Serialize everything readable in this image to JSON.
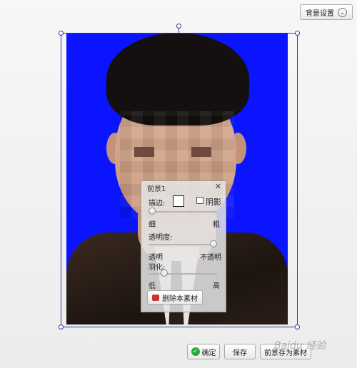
{
  "toolbar": {
    "bg_settings_label": "背景设置",
    "bg_settings_icon": "chevron-down-icon"
  },
  "photo": {
    "background_color": "#0a14ff"
  },
  "panel": {
    "title": "前景1",
    "close_label": "✕",
    "stroke_label": "描边:",
    "shadow_label": "阴影",
    "thin_label": "细",
    "thick_label": "粗",
    "opacity_label": "透明度:",
    "opaque_label": "透明",
    "transparent_label": "不透明",
    "feather_label": "羽化:",
    "low_label": "低",
    "high_label": "高",
    "stroke_level": 0.0,
    "opacity_level": 1.0,
    "feather_level": 0.2,
    "delete_label": "删除本素材"
  },
  "footer": {
    "confirm_label": "确定",
    "save_label": "保存",
    "save_fg_label": "前景存为素材"
  },
  "watermark": "Baidu 经验"
}
